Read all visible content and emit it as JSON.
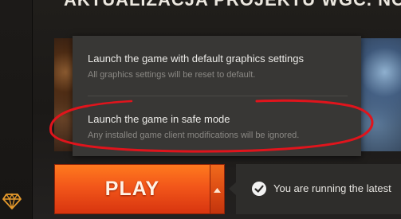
{
  "header": {
    "title": "AKTUALIZACJA PROJEKTU WGC. NOWY F"
  },
  "launch_menu": {
    "options": [
      {
        "title": "Launch the game with default graphics settings",
        "description": "All graphics settings will be reset to default."
      },
      {
        "title": "Launch the game in safe mode",
        "description": "Any installed game client modifications will be ignored."
      }
    ]
  },
  "play": {
    "label": "PLAY",
    "options_icon": "chevron-up-icon"
  },
  "status": {
    "icon": "check-circle-icon",
    "text": "You are running the latest"
  },
  "sidebar": {
    "icon": "diamond-icon"
  },
  "colors": {
    "play_orange": "#f2561a",
    "annotation_red": "#e0141c",
    "menu_bg": "#383735"
  }
}
